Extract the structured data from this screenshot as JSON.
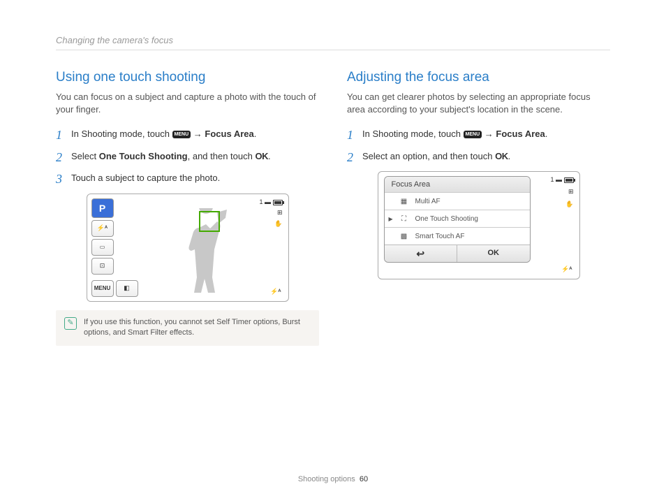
{
  "header": "Changing the camera's focus",
  "left": {
    "heading": "Using one touch shooting",
    "intro": "You can focus on a subject and capture a photo with the touch of your finger.",
    "step1_a": "In Shooting mode, touch ",
    "step1_menu": "MENU",
    "step1_b": " → ",
    "step1_c": "Focus Area",
    "step1_d": ".",
    "step2_a": "Select ",
    "step2_b": "One Touch Shooting",
    "step2_c": ", and then touch ",
    "step2_ok": "OK",
    "step2_d": ".",
    "step3": "Touch a subject to capture the photo.",
    "cam": {
      "p": "P",
      "menu": "MENU",
      "counter": "1"
    },
    "note": "If you use this function, you cannot set Self Timer options, Burst options, and Smart Filter effects."
  },
  "right": {
    "heading": "Adjusting the focus area",
    "intro": "You can get clearer photos by selecting an appropriate focus area according to your subject's location in the scene.",
    "step1_a": "In Shooting mode, touch ",
    "step1_menu": "MENU",
    "step1_b": " → ",
    "step1_c": "Focus Area",
    "step1_d": ".",
    "step2_a": "Select an option, and then touch ",
    "step2_ok": "OK",
    "step2_b": ".",
    "menu": {
      "title": "Focus Area",
      "items": [
        "Multi AF",
        "One Touch Shooting",
        "Smart Touch AF"
      ],
      "back": "↩",
      "ok": "OK",
      "counter": "1"
    }
  },
  "footer": {
    "section": "Shooting options",
    "page": "60"
  }
}
